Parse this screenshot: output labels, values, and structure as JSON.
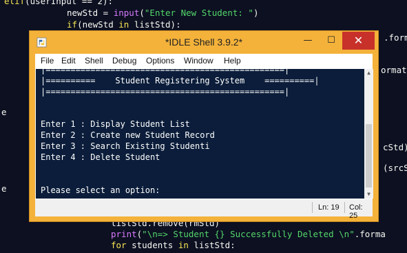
{
  "editor": {
    "line1": {
      "kw": "elif",
      "rest": "(userInput == 2):"
    },
    "line2": {
      "pre": "newStd = ",
      "fn": "input",
      "open": "(",
      "str": "\"Enter New Student: \"",
      "close": ")"
    },
    "line3": {
      "kw": "if",
      "rest": "(newStd ",
      "kw2": "in",
      "rest2": " listStd):"
    },
    "line4": {
      "text": "listStd.remove(rmStd)"
    },
    "line5": {
      "fn": "print",
      "open": "(",
      "str": "\"\\n=> Student {} Successfully Deleted \\n\"",
      "rest": ".forma"
    },
    "line6": {
      "kw": "for",
      "rest": " students ",
      "kw2": "in",
      "rest2": " listStd:"
    },
    "edge_fragments": [
      ".form",
      "ormat",
      "cStd)",
      "(srcS"
    ],
    "left_fragments": [
      "e",
      "e"
    ]
  },
  "window": {
    "title": "*IDLE Shell 3.9.2*",
    "min_glyph": "—",
    "max_glyph": "☐",
    "close_glyph": "✕"
  },
  "menu": {
    "items": [
      "File",
      "Edit",
      "Shell",
      "Debug",
      "Options",
      "Window",
      "Help"
    ]
  },
  "shell": {
    "banner_top": "|================================================|",
    "banner_title": "|==========    Student Registering System    ==========|",
    "banner_bottom": "|================================================|",
    "options": [
      "Enter 1 : Display Student List",
      "Enter 2 : Create new Student Record",
      "Enter 3 : Search Existing Studenti",
      "Enter 4 : Delete Student"
    ],
    "prompt": "Please select an option:"
  },
  "status": {
    "ln": "Ln: 19",
    "col": "Col: 25"
  },
  "colors": {
    "window_frame": "#f4b23a",
    "close_button": "#c7312a",
    "shell_bg": "#0b1d3a",
    "editor_bg": "#0c1021",
    "keyword": "#f7e553",
    "builtin": "#d97aff",
    "string": "#54d66a"
  }
}
